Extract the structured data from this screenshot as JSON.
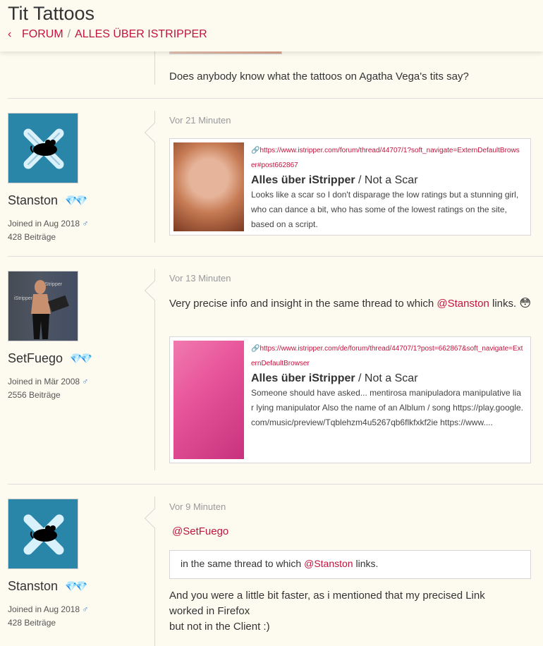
{
  "header": {
    "title": "Tit Tattoos",
    "breadcrumb_forum": "FORUM",
    "breadcrumb_sep": "/",
    "breadcrumb_section": "ALLES ÜBER ISTRIPPER"
  },
  "post0": {
    "text": "Does anybody know what the tattoos on Agatha Vega's tits say?"
  },
  "post1": {
    "username": "Stanston",
    "joined": "Joined in Aug 2018",
    "posts": "428 Beiträge",
    "time": "Vor 21 Minuten",
    "card": {
      "url": "https://www.istripper.com/forum/thread/44707/1?soft_navigate=ExternDefaultBrowser#post662867",
      "title_bold": "Alles über iStripper",
      "title_rest": " / Not a Scar",
      "desc": "Looks like a scar so I don't disparage the low ratings but a stunning girl, who can dance a bit, who has some of the lowest ratings on the site, based on a script."
    }
  },
  "post2": {
    "username": "SetFuego",
    "joined": "Joined in Mär 2008",
    "posts": "2556 Beiträge",
    "time": "Vor 13 Minuten",
    "text_before": "Very precise info and insight in the same thread to which ",
    "mention": "@Stanston",
    "text_after": " links.",
    "emoji": "😳",
    "card": {
      "url": "https://www.istripper.com/de/forum/thread/44707/1?post=662867&soft_navigate=ExternDefaultBrowser",
      "title_bold": "Alles über iStripper",
      "title_rest": " / Not a Scar",
      "desc": "Someone should have asked... mentirosa manipuladora manipulative liar lying manipulator Also the name of an Alblum / song https://play.google.com/music/preview/Tqblehzm4u5267qb6flkfxkf2ie https://www...."
    }
  },
  "post3": {
    "username": "Stanston",
    "joined": "Joined in Aug 2018",
    "posts": "428 Beiträge",
    "time": "Vor 9 Minuten",
    "mention": "@SetFuego",
    "quote_before": "in the same thread to which ",
    "quote_mention": "@Stanston",
    "quote_after": " links.",
    "line1": "And you were a little bit faster, as i mentioned that my precised Link",
    "line2": "worked in Firefox",
    "line3": "but not in the Client :)"
  },
  "icons": {
    "male": "♂",
    "link": "🔗",
    "chevron": "‹",
    "gems": "💎💎"
  },
  "colors": {
    "accent": "#c0143c",
    "background": "#fdfbf0",
    "avatar_bg": "#2a86a8"
  }
}
